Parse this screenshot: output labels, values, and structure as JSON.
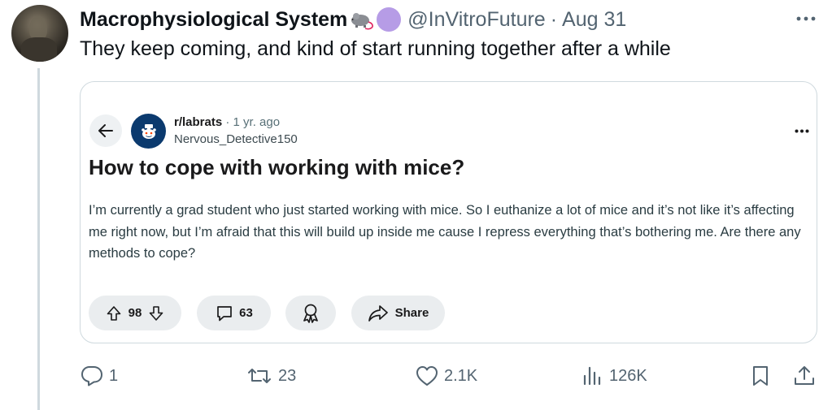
{
  "tweet": {
    "author": {
      "display_name": "Macrophysiological System",
      "handle": "@InVitroFuture",
      "separator": "·",
      "date": "Aug 31"
    },
    "text": "They keep coming, and kind of start running together after a while",
    "actions": {
      "replies": "1",
      "reposts": "23",
      "likes": "2.1K",
      "views": "126K"
    }
  },
  "embedded_post": {
    "subreddit": "r/labrats",
    "separator": "·",
    "time": "1 yr. ago",
    "username": "Nervous_Detective150",
    "title": "How to cope with working with mice?",
    "body": "I’m currently a grad student who just started working with mice. So I euthanize a lot of mice and it’s not like it’s affecting me right now, but I’m afraid that this will build up inside me cause I repress everything that’s bothering me. Are there any methods to cope?",
    "votes": "98",
    "comments": "63",
    "share_label": "Share"
  },
  "colors": {
    "text_primary": "#0f1419",
    "text_secondary": "#536471",
    "border": "#cfd9de",
    "pill_bg": "#eaedef",
    "purple_dot": "#b69ce6",
    "subreddit_avatar": "#0b3a6e"
  },
  "icons": [
    "rat-icon",
    "more-icon",
    "back-arrow-icon",
    "snoo-icon",
    "upvote-icon",
    "downvote-icon",
    "comment-icon",
    "award-icon",
    "share-arrow-icon",
    "reply-icon",
    "repost-icon",
    "like-icon",
    "views-icon",
    "bookmark-icon",
    "share-icon"
  ]
}
